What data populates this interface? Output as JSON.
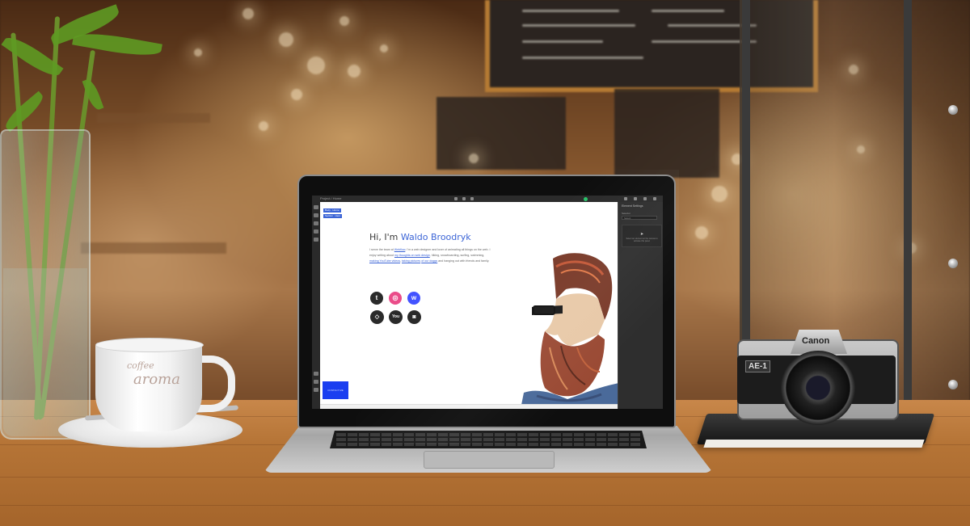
{
  "cup": {
    "logo_top": "coffee",
    "logo_main": "aroma"
  },
  "camera": {
    "brand": "Canon",
    "badge": "AE-1"
  },
  "editor": {
    "window_title": "Project / Home",
    "panel_heading": "Element Settings",
    "panel_label": "Selector",
    "panel_input_placeholder": "Select",
    "panel_note": "Select an element on the canvas to activate this panel",
    "canvas_badge_1": "Body · Home",
    "canvas_badge_2": "Section · Hero"
  },
  "site": {
    "greeting": "Hi, I'm ",
    "name": "Waldo Broodryk",
    "intro_1": "I serve the team at ",
    "link_webflow": "Webflow",
    "intro_2": ", I'm a web designer and lover of animating all things on the web. I enjoy writing about ",
    "link_thoughts": "my thoughts on web design",
    "intro_3": ", hiking, snowboarding, surfing, swimming, ",
    "link_youtube": "making YouTube videos",
    "intro_4": ", ",
    "link_pictures": "taking pictures",
    "intro_5": " ",
    "link_dogs": "of our doggs",
    "intro_6": " and hanging out with friends and family.",
    "contact_label": "CONTACT ME",
    "social": [
      {
        "name": "twitter-icon",
        "glyph": "t"
      },
      {
        "name": "dribbble-icon",
        "glyph": "◎"
      },
      {
        "name": "webflow-icon",
        "glyph": "w"
      },
      {
        "name": "codepen-icon",
        "glyph": "◇"
      },
      {
        "name": "youtube-icon",
        "glyph": "You"
      },
      {
        "name": "instagram-icon",
        "glyph": "◙"
      }
    ]
  },
  "colors": {
    "accent": "#3b64d6",
    "webflow_blue": "#4353ff",
    "dribbble_pink": "#ea4c89"
  }
}
